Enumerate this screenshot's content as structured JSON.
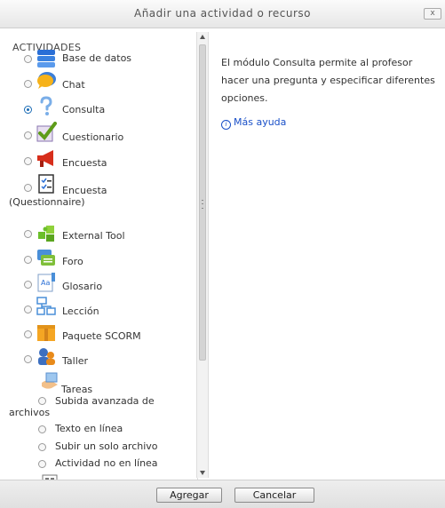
{
  "dialog": {
    "title": "Añadir una actividad o recurso",
    "close_label": "x"
  },
  "section": {
    "label": "ACTIVIDADES"
  },
  "activities": [
    {
      "label": "Base de datos",
      "icon": "database-icon",
      "selected": false
    },
    {
      "label": "Chat",
      "icon": "chat-icon",
      "selected": false
    },
    {
      "label": "Consulta",
      "icon": "question-icon",
      "selected": true
    },
    {
      "label": "Cuestionario",
      "icon": "checkmark-icon",
      "selected": false
    },
    {
      "label": "Encuesta",
      "icon": "megaphone-icon",
      "selected": false
    },
    {
      "label": "Encuesta (Questionnaire)",
      "icon": "checklist-icon",
      "selected": false
    },
    {
      "label": "External Tool",
      "icon": "puzzle-icon",
      "selected": false
    },
    {
      "label": "Foro",
      "icon": "forum-icon",
      "selected": false
    },
    {
      "label": "Glosario",
      "icon": "glossary-icon",
      "selected": false
    },
    {
      "label": "Lección",
      "icon": "lesson-icon",
      "selected": false
    },
    {
      "label": "Paquete SCORM",
      "icon": "package-icon",
      "selected": false
    },
    {
      "label": "Taller",
      "icon": "workshop-icon",
      "selected": false
    }
  ],
  "tareas": {
    "label": "Tareas",
    "icon": "assignment-icon",
    "items": [
      {
        "label": "Subida avanzada de archivos"
      },
      {
        "label": "Texto en línea"
      },
      {
        "label": "Subir un solo archivo"
      },
      {
        "label": "Actividad no en línea"
      }
    ]
  },
  "info": {
    "description": "El módulo Consulta permite al profesor hacer una pregunta y especificar diferentes opciones.",
    "help_link": "Más ayuda"
  },
  "buttons": {
    "add": "Agregar",
    "cancel": "Cancelar"
  },
  "colors": {
    "accent": "#1a6bb5",
    "link": "#1a50c8"
  }
}
